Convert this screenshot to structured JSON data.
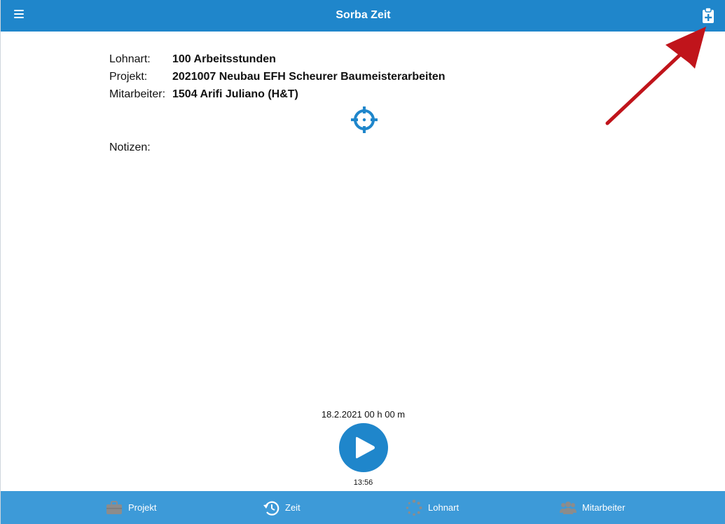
{
  "header": {
    "title": "Sorba Zeit",
    "menu_icon": "hamburger-menu-icon",
    "add_icon": "clipboard-plus-icon"
  },
  "details": {
    "rows": [
      {
        "label": "Lohnart:",
        "value": "100 Arbeitsstunden"
      },
      {
        "label": "Projekt:",
        "value": "2021007 Neubau EFH Scheurer Baumeisterarbeiten"
      },
      {
        "label": "Mitarbeiter:",
        "value": "1504 Arifi Juliano (H&T)"
      }
    ],
    "location_icon": "crosshair-icon",
    "notes_label": "Notizen:"
  },
  "timer": {
    "date_duration": "18.2.2021 00 h 00 m",
    "play_icon": "play-icon",
    "clock": "13:56"
  },
  "bottom_nav": {
    "items": [
      {
        "label": "Projekt",
        "icon": "briefcase-icon"
      },
      {
        "label": "Zeit",
        "icon": "clock-history-icon"
      },
      {
        "label": "Lohnart",
        "icon": "spinner-icon"
      },
      {
        "label": "Mitarbeiter",
        "icon": "users-icon"
      }
    ]
  },
  "colors": {
    "primary": "#1f86cb",
    "nav_background": "#3d9ad8",
    "nav_icon": "#8c8c8c",
    "annotation_arrow": "#c0141b"
  }
}
